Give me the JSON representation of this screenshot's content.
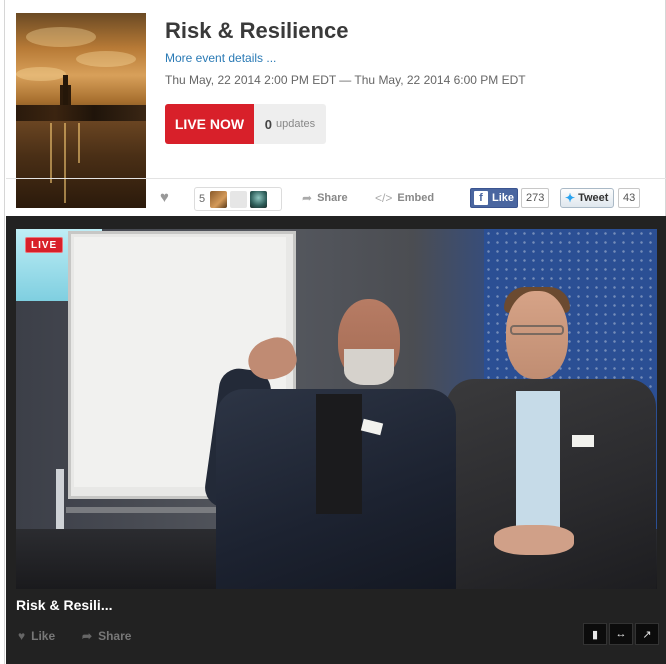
{
  "event": {
    "title": "Risk & Resilience",
    "more_details": "More event details ...",
    "dates": "Thu May, 22 2014 2:00 PM EDT — Thu May, 22 2014 6:00 PM EDT",
    "live_now_label": "LIVE NOW",
    "updates_count": "0",
    "updates_label": "updates"
  },
  "action_bar": {
    "likers_count": "5",
    "share_label": "Share",
    "embed_label": "Embed",
    "facebook_like_label": "Like",
    "facebook_like_count": "273",
    "tweet_label": "Tweet",
    "tweet_count": "43",
    "icons": [
      "heart-icon",
      "share-arrow-icon",
      "code-icon",
      "facebook-icon",
      "twitter-bird-icon"
    ]
  },
  "player": {
    "live_badge": "LIVE",
    "video_title": "Risk & Resili...",
    "like_label": "Like",
    "share_label": "Share",
    "controls": [
      "comment-icon",
      "expand-icon",
      "popout-icon"
    ]
  },
  "colors": {
    "accent_red": "#d8202a",
    "link_blue": "#2a7ab5",
    "facebook_blue": "#4a66a0",
    "twitter_blue": "#2aa3ef",
    "player_bg": "#222222"
  }
}
